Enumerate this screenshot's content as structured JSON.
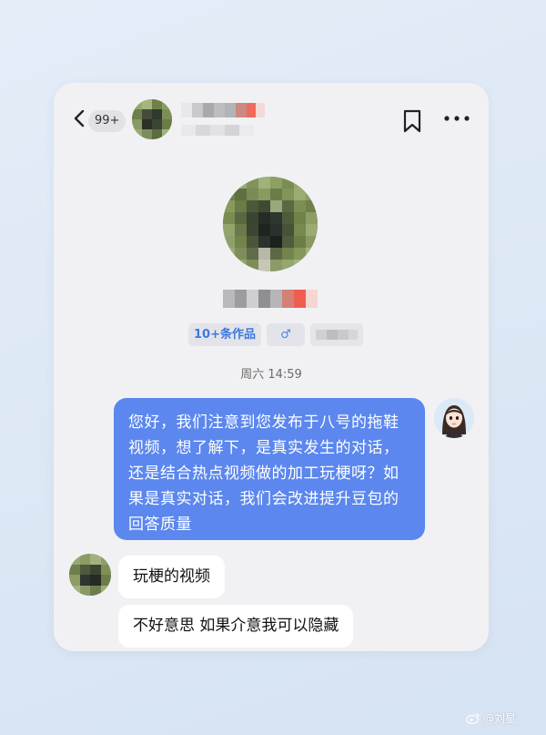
{
  "header": {
    "back_icon": "chevron-left-icon",
    "unread_count": "99+",
    "bookmark_icon": "bookmark-icon",
    "more_icon": "more-horizontal-icon"
  },
  "profile": {
    "works_tag": "10+条作品",
    "gender_symbol": "♂"
  },
  "conversation": {
    "timestamp": "周六 14:59",
    "messages": [
      {
        "from": "me",
        "text": "您好，我们注意到您发布于八号的拖鞋视频，想了解下，是真实发生的对话，还是结合热点视频做的加工玩梗呀？如果是真实对话，我们会改进提升豆包的回答质量"
      },
      {
        "from": "them",
        "text": "玩梗的视频"
      },
      {
        "from": "them",
        "text": "不好意思 如果介意我可以隐藏"
      }
    ]
  },
  "colors": {
    "outgoing_bubble": "#5b87ee",
    "incoming_bubble": "#ffffff",
    "tag_text": "#3d78e0"
  },
  "watermark": {
    "text": "@刘星",
    "icon": "weibo-icon"
  }
}
